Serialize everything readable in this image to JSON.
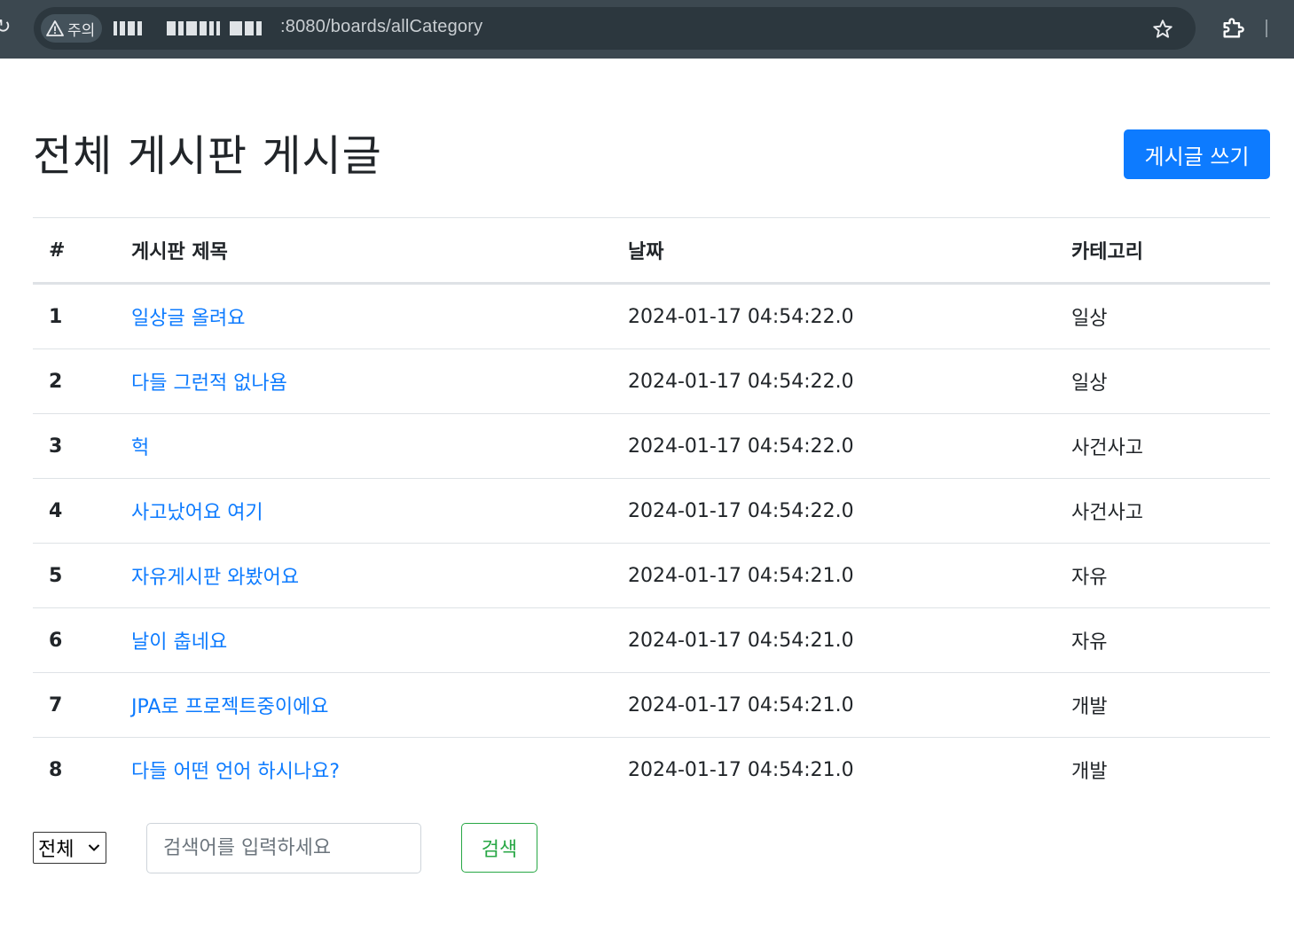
{
  "browser": {
    "security_label": "주의",
    "url_visible": ":8080/boards/allCategory"
  },
  "page": {
    "title": "전체 게시판 게시글",
    "write_button": "게시글 쓰기"
  },
  "table": {
    "headers": [
      "#",
      "게시판 제목",
      "날짜",
      "카테고리"
    ],
    "rows": [
      {
        "num": "1",
        "title": "일상글 올려요",
        "date": "2024-01-17 04:54:22.0",
        "category": "일상"
      },
      {
        "num": "2",
        "title": "다들 그런적 없나욤",
        "date": "2024-01-17 04:54:22.0",
        "category": "일상"
      },
      {
        "num": "3",
        "title": "헉",
        "date": "2024-01-17 04:54:22.0",
        "category": "사건사고"
      },
      {
        "num": "4",
        "title": "사고났어요 여기",
        "date": "2024-01-17 04:54:22.0",
        "category": "사건사고"
      },
      {
        "num": "5",
        "title": "자유게시판 와봤어요",
        "date": "2024-01-17 04:54:21.0",
        "category": "자유"
      },
      {
        "num": "6",
        "title": "날이 춥네요",
        "date": "2024-01-17 04:54:21.0",
        "category": "자유"
      },
      {
        "num": "7",
        "title": "JPA로 프로젝트중이에요",
        "date": "2024-01-17 04:54:21.0",
        "category": "개발"
      },
      {
        "num": "8",
        "title": "다들 어떤 언어 하시나요?",
        "date": "2024-01-17 04:54:21.0",
        "category": "개발"
      }
    ]
  },
  "search": {
    "select_value": "전체",
    "placeholder": "검색어를 입력하세요",
    "button": "검색"
  },
  "colors": {
    "primary": "#0d7bff",
    "success": "#28a745",
    "chrome_bg": "#3c4850"
  },
  "icons": {
    "security": "warning-triangle-icon",
    "bookmark": "star-icon",
    "extensions": "puzzle-icon",
    "select_arrow": "chevron-down-icon"
  }
}
